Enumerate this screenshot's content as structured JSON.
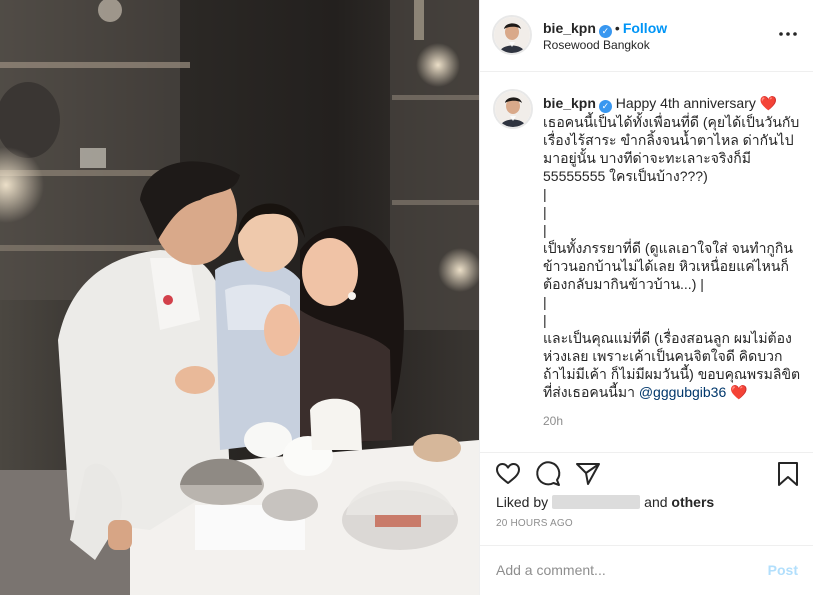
{
  "post": {
    "username": "bie_kpn",
    "verified_glyph": "✓",
    "separator": "•",
    "follow_label": "Follow",
    "location": "Rosewood Bangkok",
    "more_label": "•••"
  },
  "caption": {
    "username": "bie_kpn",
    "line1": " Happy 4th anniversary ",
    "heart1": "❤️",
    "body": "\nเธอคนนี้เป็นได้ทั้งเพื่อนที่ดี (คุยได้เป็นวันกับเรื่องไร้สาระ ขำกลิ้งจนน้ำตาไหล ด่ากันไปมาอยู่นั้น บางทีด่าจะทะเลาะจริงก็มี 55555555 ใครเป็นบ้าง???)\n|\n|\n|\nเป็นทั้งภรรยาที่ดี (ดูแลเอาใจใส่ จนทำกูกินข้าวนอกบ้านไม่ได้เลย หิวเหนื่อยแค่ไหนก็ต้องกลับมากินข้าวบ้าน...) |\n|\n|\nและเป็นคุณแม่ที่ดี (เรื่องสอนลูก ผมไม่ต้องห่วงเลย เพราะเค้าเป็นคนจิตใจดี คิดบวก ถ้าไม่มีเค้า ก็ไม่มีผมวันนี้) ขอบคุณพรมลิขิต ที่ส่งเธอคนนี้มา ",
    "mention": "@gggubgib36",
    "heart2": " ❤️",
    "time": "20h"
  },
  "actions": {
    "liked_by_prefix": "Liked by",
    "and_label": "and",
    "others_label": "others",
    "posted_ago": "20 HOURS AGO"
  },
  "comment_box": {
    "placeholder": "Add a comment...",
    "post_label": "Post"
  },
  "colors": {
    "accent": "#0095f6",
    "verified": "#3897f0",
    "heart": "#ed4956",
    "post_disabled": "#b2dffc"
  }
}
